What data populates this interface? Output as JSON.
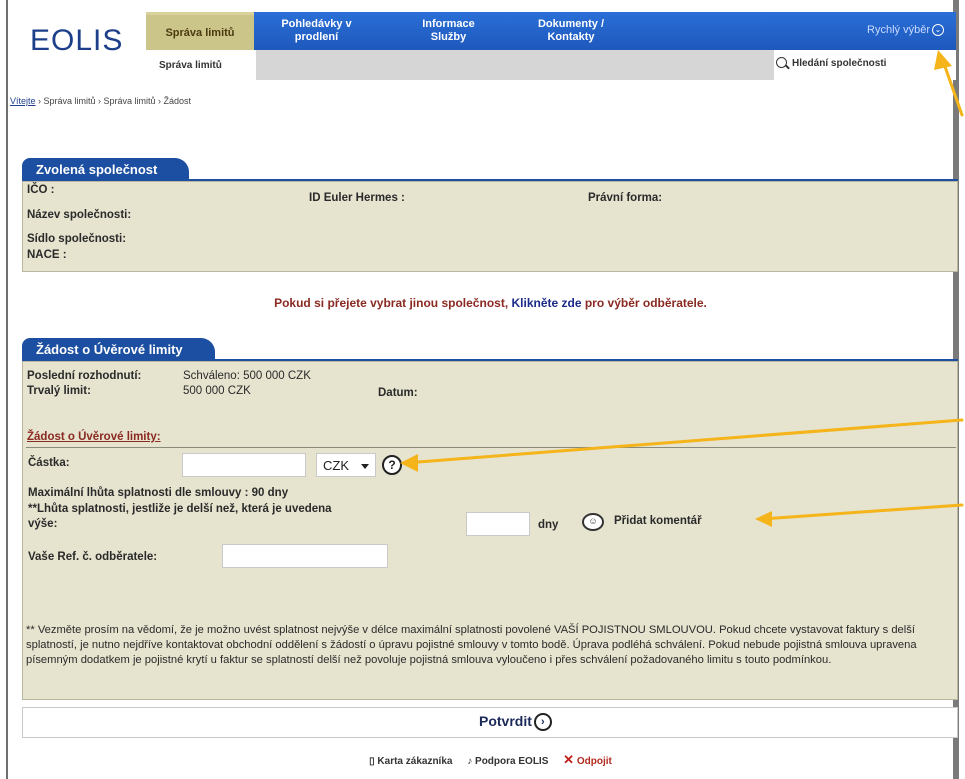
{
  "header": {
    "logo_text": "EOLIS",
    "nav": {
      "active": "Správa limitů",
      "item1_line1": "Pohledávky v",
      "item1_line2": "prodlení",
      "item2_line1": "Informace",
      "item2_line2": "Služby",
      "item3_line1": "Dokumenty /",
      "item3_line2": "Kontakty"
    },
    "quick_select": "Rychlý výběr",
    "subnav_tab": "Správa limitů",
    "search_link": "Hledání společnosti"
  },
  "breadcrumb": {
    "home": "Vítejte",
    "rest": " › Správa limitů › Správa limitů › Žádost"
  },
  "company_panel": {
    "title": "Zvolená společnost",
    "ico": "IČO :",
    "id_eh": "ID Euler Hermes :",
    "legal_form": "Právní forma:",
    "name": "Název společnosti:",
    "seat": "Sídlo společnosti:",
    "nace": "NACE :"
  },
  "choose_line": {
    "pre": "Pokud si přejete vybrat jinou společnost, ",
    "link": "Klikněte zde",
    "post": " pro výběr odběratele."
  },
  "limit_panel": {
    "title": "Žádost o Úvěrové limity",
    "last_decision_label": "Poslední rozhodnutí:",
    "last_decision_value": "Schváleno: 500 000 CZK",
    "permanent_label": "Trvalý limit:",
    "permanent_value": "500 000 CZK",
    "date_label": "Datum:",
    "section_title": "Žádost o Úvěrové limity:",
    "amount_label": "Částka:",
    "amount_value": "",
    "currency": "CZK",
    "help": "?",
    "max_term": "Maximální lhůta splatnosti dle smlouvy :  90 dny",
    "term_line1": "**Lhůta splatnosti, jestliže je delší než, která je uvedena",
    "term_line2": "výše:",
    "days": "dny",
    "add_comment": "Přidat komentář",
    "ref_label": "Vaše Ref. č. odběratele:",
    "note": "** Vezměte prosím na vědomí, že je možno uvést splatnost nejvýše v délce maximální splatnosti povolené VAŠÍ POJISTNOU SMLOUVOU. Pokud chcete vystavovat faktury s delší splatností, je nutno nejdříve kontaktovat obchodní oddělení s žádostí o úpravu pojistné smlouvy v tomto bodě. Úprava podléhá schválení. Pokud nebude pojistná smlouva upravena písemným dodatkem je pojistné krytí u faktur se splatností delší než povoluje pojistná smlouva vyloučeno i přes schválení požadovaného limitu s touto podmínkou."
  },
  "confirm": "Potvrdit",
  "footer": {
    "card": "Karta zákazníka",
    "support": "Podpora EOLIS",
    "logout": "Odpojit"
  },
  "colors": {
    "nav_blue": "#1e58bd",
    "panel_tab": "#1c4fa1",
    "panel_bg": "#e6e3cf",
    "accent_red": "#8a2a22",
    "arrow": "#f4b41a"
  }
}
